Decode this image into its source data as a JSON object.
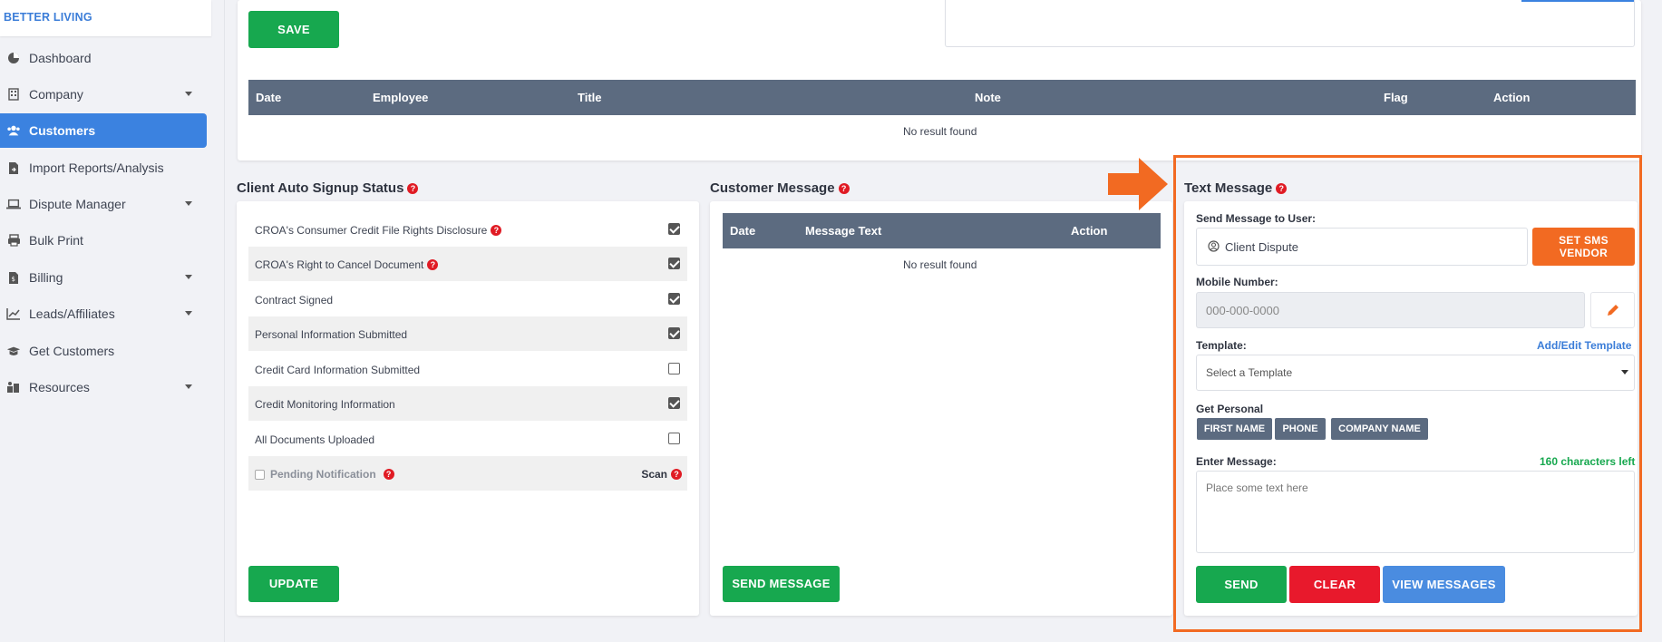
{
  "sidebar": {
    "brand": "BETTER LIVING",
    "items": [
      {
        "label": "Dashboard",
        "icon": "dashboard-icon"
      },
      {
        "label": "Company",
        "icon": "building-icon"
      },
      {
        "label": "Customers",
        "icon": "users-icon"
      },
      {
        "label": "Import Reports/Analysis",
        "icon": "file-import-icon"
      },
      {
        "label": "Dispute Manager",
        "icon": "laptop-icon"
      },
      {
        "label": "Bulk Print",
        "icon": "printer-icon"
      },
      {
        "label": "Billing",
        "icon": "billing-icon"
      },
      {
        "label": "Leads/Affiliates",
        "icon": "chart-line-icon"
      },
      {
        "label": "Get Customers",
        "icon": "graduation-cap-icon"
      },
      {
        "label": "Resources",
        "icon": "resources-icon"
      }
    ]
  },
  "notes": {
    "save_label": "SAVE",
    "columns": [
      "Date",
      "Employee",
      "Title",
      "Note",
      "Flag",
      "Action"
    ],
    "empty": "No result found"
  },
  "signup": {
    "title": "Client Auto Signup Status",
    "rows": [
      {
        "label": "CROA's Consumer Credit File Rights Disclosure",
        "checked": true
      },
      {
        "label": "CROA's Right to Cancel Document",
        "checked": true
      },
      {
        "label": "Contract Signed",
        "checked": true
      },
      {
        "label": "Personal Information Submitted",
        "checked": true
      },
      {
        "label": "Credit Card Information Submitted",
        "checked": false
      },
      {
        "label": "Credit Monitoring Information",
        "checked": true
      },
      {
        "label": "All Documents Uploaded",
        "checked": false
      }
    ],
    "pending_label": "Pending Notification",
    "scan_label": "Scan",
    "update_label": "UPDATE"
  },
  "customer_message": {
    "title": "Customer Message",
    "columns": [
      "Date",
      "Message Text",
      "Action"
    ],
    "empty": "No result found",
    "send_label": "SEND MESSAGE"
  },
  "text_message": {
    "title": "Text Message",
    "send_to_label": "Send Message to User:",
    "send_to_value": "Client Dispute",
    "set_sms_vendor": "SET SMS VENDOR",
    "mobile_label": "Mobile Number:",
    "mobile_placeholder": "000-000-0000",
    "template_label": "Template:",
    "template_link": "Add/Edit Template",
    "template_value": "Select a Template",
    "get_personal_label": "Get Personal",
    "tags": [
      "FIRST NAME",
      "PHONE",
      "COMPANY NAME"
    ],
    "enter_message_label": "Enter Message:",
    "chars_left": "160 characters left",
    "message_placeholder": "Place some text here",
    "send_label": "SEND",
    "clear_label": "CLEAR",
    "view_label": "VIEW MESSAGES"
  },
  "colors": {
    "accent_blue": "#3b82e0",
    "green": "#17a84f",
    "red": "#e8192c",
    "orange": "#f26a22",
    "table_header": "#5c6b80"
  }
}
